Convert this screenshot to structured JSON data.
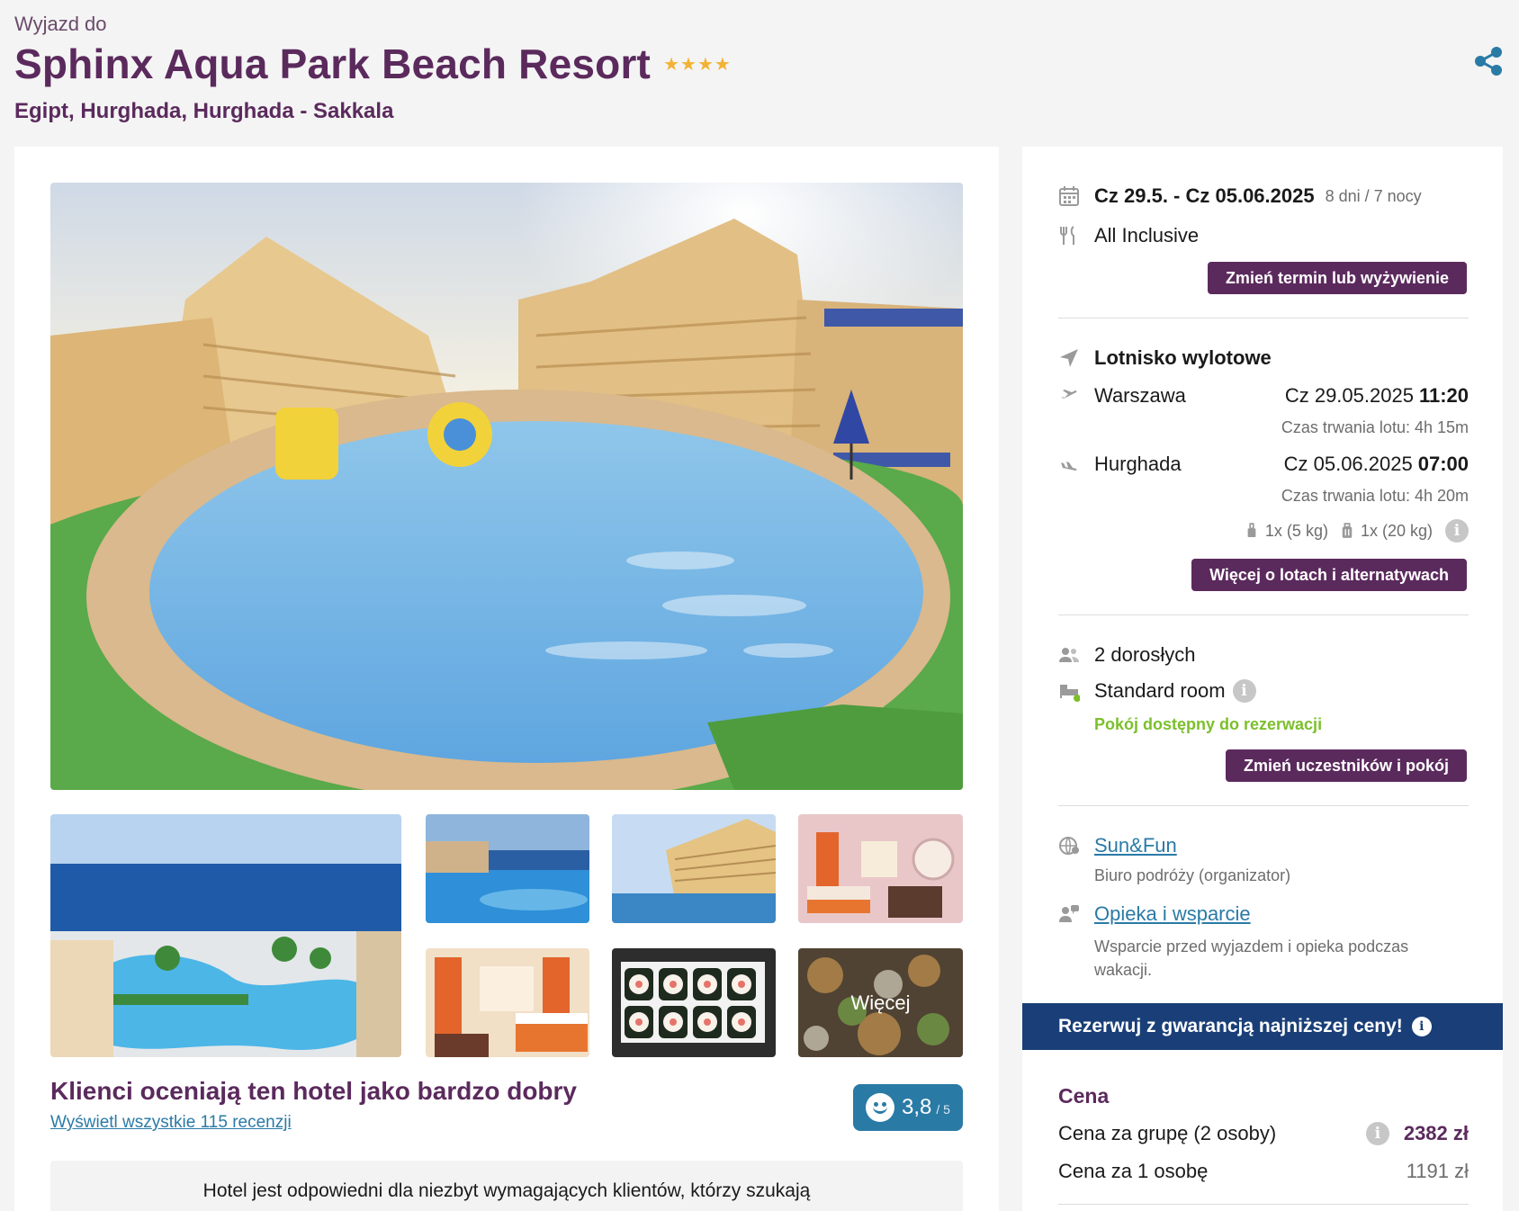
{
  "header": {
    "pre_title": "Wyjazd do",
    "title": "Sphinx Aqua Park Beach Resort",
    "stars": "★★★★",
    "location": "Egipt, Hurghada, Hurghada - Sakkala",
    "share_icon": "share-icon"
  },
  "gallery": {
    "more_label": "Więcej",
    "photos": [
      "hotel-pool-main",
      "aerial-pool-sea",
      "infinity-pool",
      "hotel-building-pool",
      "hotel-room-1",
      "hotel-room-2",
      "sushi-buffet",
      "buffet-food"
    ]
  },
  "rating": {
    "headline": "Klienci oceniają ten hotel jako bardzo dobry",
    "reviews_link": "Wyświetl wszystkie 115 recenzji",
    "score": "3,8",
    "score_of": "/ 5",
    "description": "Hotel jest odpowiedni dla niezbyt wymagających klientów, którzy szukają"
  },
  "booking": {
    "dates": "Cz 29.5. - Cz 05.06.2025",
    "duration": "8 dni / 7 nocy",
    "board": "All Inclusive",
    "change_term_btn": "Zmień termin lub wyżywienie",
    "airport_label": "Lotnisko wylotowe",
    "outbound": {
      "city": "Warszawa",
      "date": "Cz 29.05.2025",
      "time": "11:20",
      "duration": "Czas trwania lotu: 4h 15m"
    },
    "return": {
      "city": "Hurghada",
      "date": "Cz 05.06.2025",
      "time": "07:00",
      "duration": "Czas trwania lotu: 4h 20m"
    },
    "baggage_hand": "1x (5 kg)",
    "baggage_hold": "1x (20 kg)",
    "flights_btn": "Więcej o lotach i alternatywach",
    "travellers": "2 dorosłych",
    "room": "Standard room",
    "room_status": "Pokój dostępny do rezerwacji",
    "change_people_btn": "Zmień uczestników i pokój",
    "organizer_name": "Sun&Fun",
    "organizer_desc": "Biuro podróży (organizator)",
    "support_link": "Opieka i wsparcie",
    "support_desc": "Wsparcie przed wyjazdem i opieka podczas wakacji."
  },
  "guarantee": {
    "label": "Rezerwuj z gwarancją najniższej ceny!"
  },
  "price": {
    "heading": "Cena",
    "group_label": "Cena za grupę (2 osoby)",
    "group_value": "2382 zł",
    "person_label": "Cena za 1 osobę",
    "person_value": "1191 zł"
  },
  "colors": {
    "brand": "#5b2a5d",
    "link": "#2a7aa6",
    "guarantee": "#1a3f78",
    "available": "#7cbf2b"
  }
}
